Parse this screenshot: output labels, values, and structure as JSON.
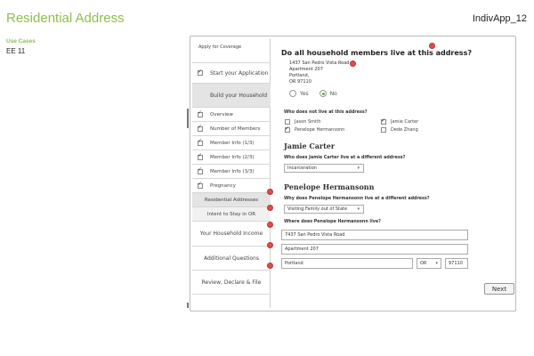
{
  "page": {
    "title": "Residential Address",
    "app_id": "IndivApp_12"
  },
  "use_cases": {
    "label": "Use Cases",
    "value": "EE 11"
  },
  "sidebar": {
    "header": "Apply for Coverage",
    "items": [
      {
        "label": "Start your Application",
        "checked": true
      },
      {
        "label": "Build your Household",
        "checked": false
      },
      {
        "label": "Overview",
        "checked": true
      },
      {
        "label": "Number of Members",
        "checked": true
      },
      {
        "label": "Member Info (1/3)",
        "checked": true
      },
      {
        "label": "Member Info (2/3)",
        "checked": true
      },
      {
        "label": "Member Info (3/3)",
        "checked": true
      },
      {
        "label": "Pregnancy",
        "checked": true
      },
      {
        "label": "Residential Addresses",
        "checked": false
      },
      {
        "label": "Intent to Stay in OR",
        "checked": false
      },
      {
        "label": "Your Household Income",
        "checked": false
      },
      {
        "label": "Additional Questions",
        "checked": false
      },
      {
        "label": "Review, Declare & File",
        "checked": false
      }
    ]
  },
  "main": {
    "question": "Do all household members live at this address?",
    "address": [
      "1437 San Pedro Vista Road",
      "Apartment 207",
      "Portland,",
      "OR 97110"
    ],
    "options": {
      "yes": "Yes",
      "no": "No",
      "selected": "No"
    },
    "who_not_live_label": "Who does not live at this address?",
    "members": [
      {
        "name": "Jason Smith",
        "checked": false
      },
      {
        "name": "Jamie Carter",
        "checked": true
      },
      {
        "name": "Penelope Hermansonn",
        "checked": true
      },
      {
        "name": "Dede Zhang",
        "checked": false
      }
    ],
    "person1": {
      "name": "Jamie Carter",
      "question": "Who does Jamie Carter live at a different address?",
      "select_value": "Incarceration"
    },
    "person2": {
      "name": "Penelope Hermansonn",
      "question": "Why does Penelope Hermansonn live at a different address?",
      "select_value": "Visiting Family out of State",
      "where_label": "Where does Penelope Hermansonn live?",
      "street": "7437 San Pedro Vista Road",
      "apartment": "Apartment 207",
      "city": "Portland",
      "state": "OR",
      "zip": "97110"
    },
    "next": "Next"
  },
  "colors": {
    "accent_green": "#8cbf4a",
    "badge_red": "#e24b4b"
  }
}
